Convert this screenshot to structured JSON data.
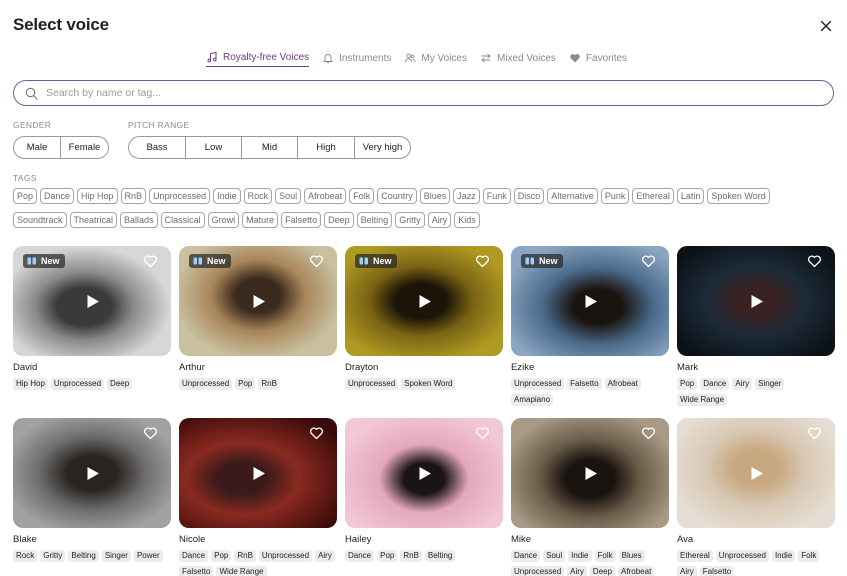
{
  "dialog": {
    "title": "Select voice"
  },
  "tabs": [
    {
      "label": "Royalty-free Voices",
      "icon": "music-note-icon",
      "active": true
    },
    {
      "label": "Instruments",
      "icon": "bell-icon",
      "active": false
    },
    {
      "label": "My Voices",
      "icon": "users-icon",
      "active": false
    },
    {
      "label": "Mixed Voices",
      "icon": "swap-arrows-icon",
      "active": false
    },
    {
      "label": "Favorites",
      "icon": "heart-icon",
      "active": false
    }
  ],
  "search": {
    "placeholder": "Search by name or tag...",
    "value": ""
  },
  "filters": {
    "gender_label": "GENDER",
    "gender": [
      "Male",
      "Female"
    ],
    "pitch_label": "PITCH RANGE",
    "pitch": [
      "Bass",
      "Low",
      "Mid",
      "High",
      "Very high"
    ],
    "tags_label": "TAGS",
    "tags": [
      "Pop",
      "Dance",
      "Hip Hop",
      "RnB",
      "Unprocessed",
      "Indie",
      "Rock",
      "Soul",
      "Afrobeat",
      "Folk",
      "Country",
      "Blues",
      "Jazz",
      "Funk",
      "Disco",
      "Alternative",
      "Punk",
      "Ethereal",
      "Latin",
      "Spoken Word",
      "Soundtrack",
      "Theatrical",
      "Ballads",
      "Classical",
      "Growl",
      "Mature",
      "Falsetto",
      "Deep",
      "Belting",
      "Gritty",
      "Airy",
      "Kids"
    ]
  },
  "new_badge_label": "New",
  "voices": [
    {
      "name": "David",
      "is_new": true,
      "tags": [
        "Hip Hop",
        "Unprocessed",
        "Deep"
      ]
    },
    {
      "name": "Arthur",
      "is_new": true,
      "tags": [
        "Unprocessed",
        "Pop",
        "RnB"
      ]
    },
    {
      "name": "Drayton",
      "is_new": true,
      "tags": [
        "Unprocessed",
        "Spoken Word"
      ]
    },
    {
      "name": "Ezike",
      "is_new": true,
      "tags": [
        "Unprocessed",
        "Falsetto",
        "Afrobeat",
        "Amapiano"
      ]
    },
    {
      "name": "Mark",
      "is_new": false,
      "tags": [
        "Pop",
        "Dance",
        "Airy",
        "Singer",
        "Wide Range"
      ]
    },
    {
      "name": "Blake",
      "is_new": false,
      "tags": [
        "Rock",
        "Gritty",
        "Belting",
        "Singer",
        "Power"
      ]
    },
    {
      "name": "Nicole",
      "is_new": false,
      "tags": [
        "Dance",
        "Pop",
        "RnB",
        "Unprocessed",
        "Airy",
        "Falsetto",
        "Wide Range"
      ]
    },
    {
      "name": "Hailey",
      "is_new": false,
      "tags": [
        "Dance",
        "Pop",
        "RnB",
        "Belting"
      ]
    },
    {
      "name": "Mike",
      "is_new": false,
      "tags": [
        "Dance",
        "Soul",
        "Indie",
        "Folk",
        "Blues",
        "Unprocessed",
        "Airy",
        "Deep",
        "Afrobeat"
      ]
    },
    {
      "name": "Ava",
      "is_new": false,
      "tags": [
        "Ethereal",
        "Unprocessed",
        "Indie",
        "Folk",
        "Airy",
        "Falsetto"
      ]
    }
  ]
}
